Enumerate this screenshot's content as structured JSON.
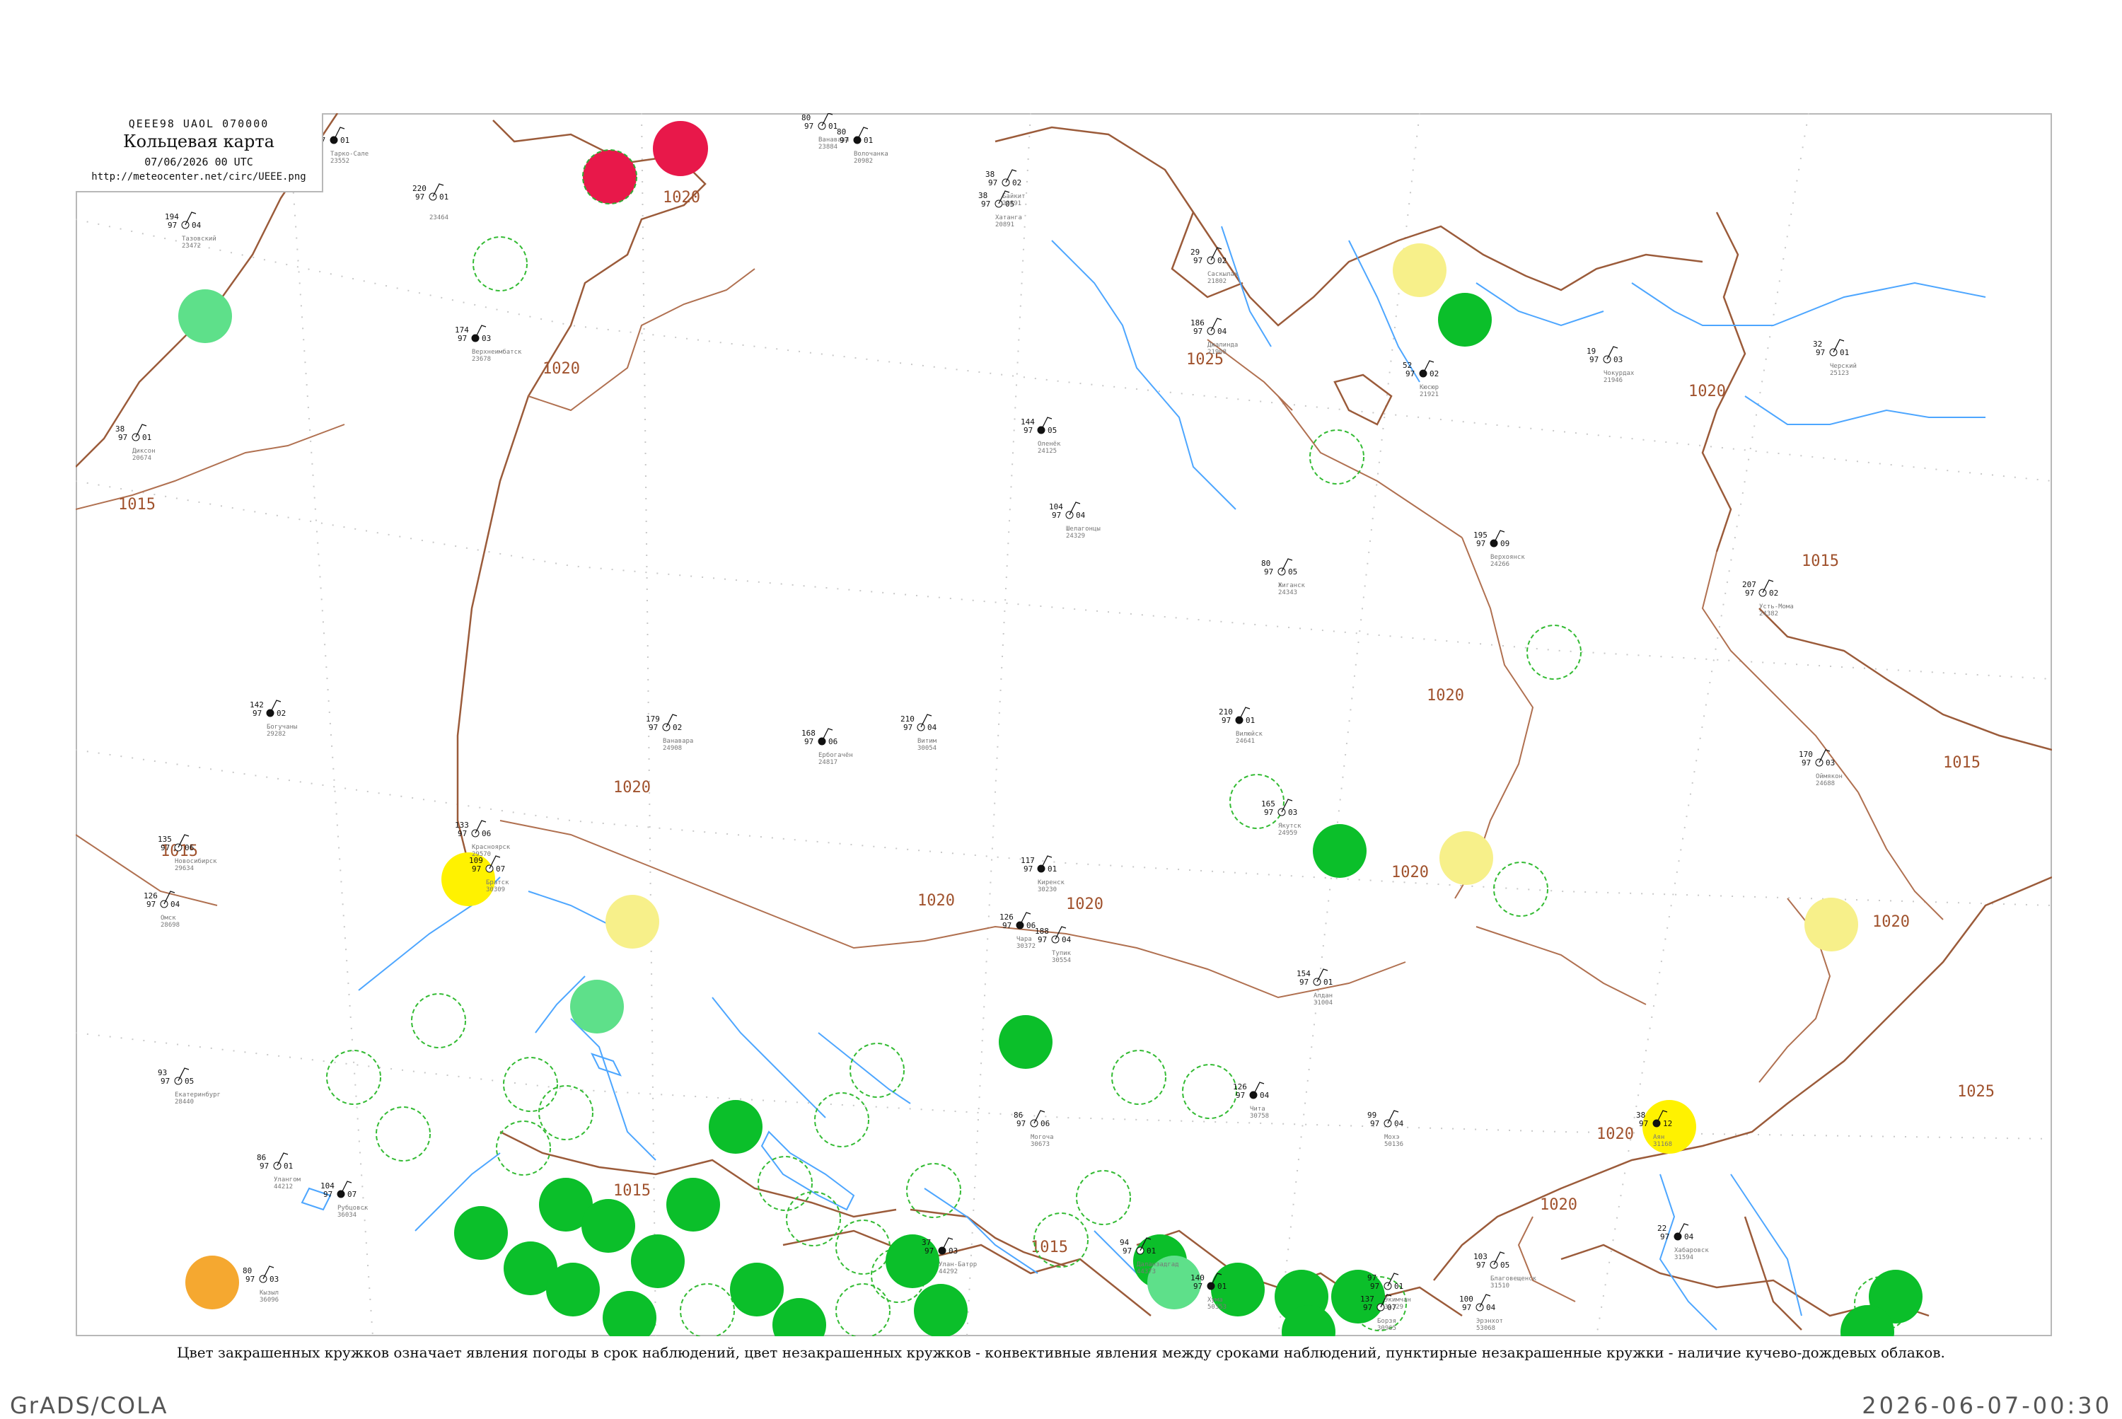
{
  "header": {
    "code": "QEEE98  UAOL  070000",
    "title": "Кольцевая карта",
    "date": "07/06/2026 00 UTC",
    "url": "http://meteocenter.net/circ/UEEE.png"
  },
  "caption": "Цвет закрашенных кружков означает явления погоды в срок наблюдений, цвет незакрашенных кружков - конвективные явления между сроками наблюдений, пунктирные незакрашенные кружки - наличие кучево-дождевых облаков.",
  "footer": {
    "left": "GrADS/COLA",
    "right": "2026-06-07-00:30"
  },
  "colors": {
    "rain": "#0bbf2a",
    "rain_light": "#5ee08a",
    "thunder": "#e8184a",
    "haze": "#f7f08a",
    "smoke": "#fff200",
    "dust": "#f5a830",
    "isobar": "#a0522d",
    "river": "#4da6ff",
    "border": "#9b5b3a"
  },
  "isobar_labels": [
    {
      "text": "1020"
    },
    {
      "text": "1025"
    },
    {
      "text": "1020"
    },
    {
      "text": "1020"
    },
    {
      "text": "1015"
    },
    {
      "text": "1015"
    },
    {
      "text": "1015"
    },
    {
      "text": "1020"
    },
    {
      "text": "1020"
    },
    {
      "text": "1020"
    },
    {
      "text": "1015"
    },
    {
      "text": "1020"
    },
    {
      "text": "1020"
    },
    {
      "text": "1025"
    },
    {
      "text": "1020"
    },
    {
      "text": "1020"
    },
    {
      "text": "1015"
    },
    {
      "text": "1015"
    },
    {
      "text": "1020"
    }
  ],
  "stations": [
    {
      "id": "23552",
      "t": "97",
      "p": "01",
      "v": "",
      "name": "Тарко-Сале"
    },
    {
      "id": "23464",
      "t": "97",
      "p": "01",
      "v": "220",
      "name": ""
    },
    {
      "id": "23472",
      "t": "97",
      "p": "04",
      "v": "194",
      "name": "Тазовский"
    },
    {
      "id": "23678",
      "t": "97",
      "p": "03",
      "v": "174",
      "name": "Верхнеимбатск"
    },
    {
      "id": "23891",
      "t": "97",
      "p": "02",
      "v": "38",
      "name": "Байкит"
    },
    {
      "id": "23884",
      "t": "97",
      "p": "01",
      "v": "80",
      "name": "Ванавара"
    },
    {
      "id": "24125",
      "t": "97",
      "p": "05",
      "v": "144",
      "name": "Оленёк"
    },
    {
      "id": "24329",
      "t": "97",
      "p": "04",
      "v": "104",
      "name": "Шелагонцы"
    },
    {
      "id": "24343",
      "t": "97",
      "p": "05",
      "v": "80",
      "name": "Жиганск"
    },
    {
      "id": "24266",
      "t": "97",
      "p": "09",
      "v": "195",
      "name": "Верхоянск"
    },
    {
      "id": "24382",
      "t": "97",
      "p": "02",
      "v": "207",
      "name": "Усть-Мома"
    },
    {
      "id": "24688",
      "t": "97",
      "p": "03",
      "v": "170",
      "name": "Оймякон"
    },
    {
      "id": "24641",
      "t": "97",
      "p": "01",
      "v": "210",
      "name": "Вилюйск"
    },
    {
      "id": "24959",
      "t": "97",
      "p": "03",
      "v": "165",
      "name": "Якутск"
    },
    {
      "id": "24908",
      "t": "97",
      "p": "02",
      "v": "179",
      "name": "Ванавара"
    },
    {
      "id": "24817",
      "t": "97",
      "p": "06",
      "v": "168",
      "name": "Ербогачён"
    },
    {
      "id": "25123",
      "t": "97",
      "p": "01",
      "v": "32",
      "name": "Черский"
    },
    {
      "id": "21908",
      "t": "97",
      "p": "04",
      "v": "186",
      "name": "Джалинда"
    },
    {
      "id": "21921",
      "t": "97",
      "p": "02",
      "v": "52",
      "name": "Кюсюр"
    },
    {
      "id": "21946",
      "t": "97",
      "p": "03",
      "v": "19",
      "name": "Чокурдах"
    },
    {
      "id": "20674",
      "t": "97",
      "p": "01",
      "v": "38",
      "name": "Диксон"
    },
    {
      "id": "20982",
      "t": "97",
      "p": "01",
      "v": "80",
      "name": "Волочанка"
    },
    {
      "id": "20891",
      "t": "97",
      "p": "05",
      "v": "38",
      "name": "Хатанга"
    },
    {
      "id": "21802",
      "t": "97",
      "p": "02",
      "v": "29",
      "name": "Саскылах"
    },
    {
      "id": "30230",
      "t": "97",
      "p": "01",
      "v": "117",
      "name": "Киренск"
    },
    {
      "id": "30309",
      "t": "97",
      "p": "07",
      "v": "109",
      "name": "Братск"
    },
    {
      "id": "30054",
      "t": "97",
      "p": "04",
      "v": "210",
      "name": "Витим"
    },
    {
      "id": "30372",
      "t": "97",
      "p": "06",
      "v": "126",
      "name": "Чара"
    },
    {
      "id": "30554",
      "t": "97",
      "p": "04",
      "v": "188",
      "name": "Тупик"
    },
    {
      "id": "30673",
      "t": "97",
      "p": "06",
      "v": "86",
      "name": "Могоча"
    },
    {
      "id": "30758",
      "t": "97",
      "p": "04",
      "v": "126",
      "name": "Чита"
    },
    {
      "id": "30965",
      "t": "97",
      "p": "07",
      "v": "137",
      "name": "Борзя"
    },
    {
      "id": "31004",
      "t": "97",
      "p": "01",
      "v": "154",
      "name": "Алдан"
    },
    {
      "id": "31168",
      "t": "97",
      "p": "12",
      "v": "38",
      "name": "Аян"
    },
    {
      "id": "31329",
      "t": "97",
      "p": "01",
      "v": "97",
      "name": "Экимчан"
    },
    {
      "id": "31510",
      "t": "97",
      "p": "05",
      "v": "103",
      "name": "Благовещенск"
    },
    {
      "id": "31594",
      "t": "97",
      "p": "04",
      "v": "22",
      "name": "Хабаровск"
    },
    {
      "id": "29634",
      "t": "97",
      "p": "06",
      "v": "135",
      "name": "Новосибирск"
    },
    {
      "id": "29570",
      "t": "97",
      "p": "06",
      "v": "133",
      "name": "Красноярск"
    },
    {
      "id": "29282",
      "t": "97",
      "p": "02",
      "v": "142",
      "name": "Богучаны"
    },
    {
      "id": "28698",
      "t": "97",
      "p": "04",
      "v": "126",
      "name": "Омск"
    },
    {
      "id": "28440",
      "t": "97",
      "p": "05",
      "v": "93",
      "name": "Екатеринбург"
    },
    {
      "id": "36034",
      "t": "97",
      "p": "07",
      "v": "104",
      "name": "Рубцовск"
    },
    {
      "id": "36096",
      "t": "97",
      "p": "03",
      "v": "80",
      "name": "Кызыл"
    },
    {
      "id": "44212",
      "t": "97",
      "p": "01",
      "v": "86",
      "name": "Улангом"
    },
    {
      "id": "44292",
      "t": "97",
      "p": "03",
      "v": "37",
      "name": "Улан-Батор"
    },
    {
      "id": "44373",
      "t": "97",
      "p": "01",
      "v": "94",
      "name": "Даланзадгад"
    },
    {
      "id": "53068",
      "t": "97",
      "p": "04",
      "v": "100",
      "name": "Эрэнхот"
    },
    {
      "id": "50353",
      "t": "97",
      "p": "01",
      "v": "140",
      "name": "Хума"
    },
    {
      "id": "50136",
      "t": "97",
      "p": "04",
      "v": "99",
      "name": "Мохэ"
    }
  ]
}
